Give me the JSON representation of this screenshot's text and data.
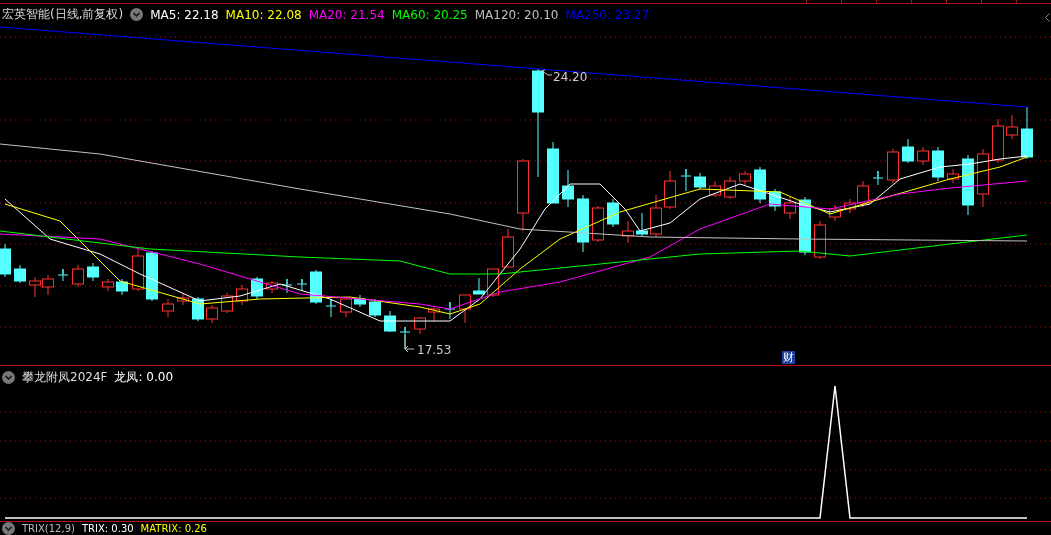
{
  "main_panel": {
    "title": "宏英智能(日线,前复权)",
    "ma_readings": [
      {
        "text": "MA5: 22.18",
        "color": "#ffffff"
      },
      {
        "text": "MA10: 22.08",
        "color": "#ffff00"
      },
      {
        "text": "MA20: 21.54",
        "color": "#ff00ff"
      },
      {
        "text": "MA60: 20.25",
        "color": "#00ff00"
      },
      {
        "text": "MA120: 20.10",
        "color": "#c0c0c0"
      },
      {
        "text": "MA250: 23.27",
        "color": "#0000ff"
      }
    ],
    "high_label": "24.20",
    "low_label": "17.53",
    "marker": "财"
  },
  "indicator_panel": {
    "name": "攀龙附凤2024F",
    "reading": "龙凤: 0.00"
  },
  "trix_panel": {
    "name": "TRIX(12,9)",
    "readings": [
      {
        "text": "TRIX: 0.30",
        "color": "#ffffff"
      },
      {
        "text": "MATRIX: 0.26",
        "color": "#ffff00"
      }
    ]
  }
}
